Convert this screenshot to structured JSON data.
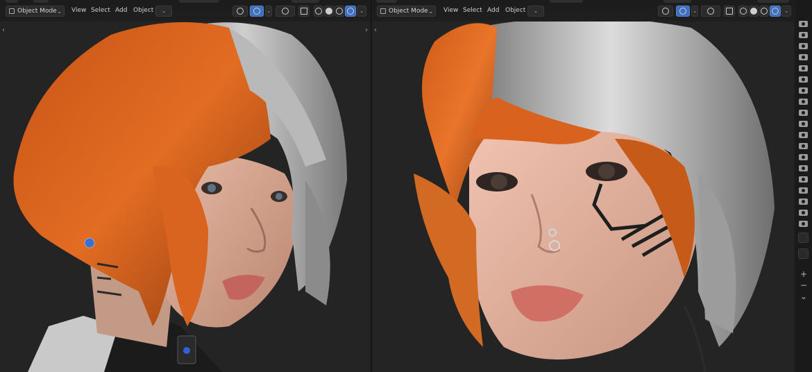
{
  "viewports": [
    {
      "name": "left",
      "header": {
        "mode_label": "Object Mode",
        "menu": [
          "View",
          "Select",
          "Add",
          "Object"
        ]
      }
    },
    {
      "name": "right",
      "header": {
        "mode_label": "Object Mode",
        "menu": [
          "View",
          "Select",
          "Add",
          "Object"
        ]
      }
    }
  ],
  "icons": {
    "mode": "object-mode-icon",
    "shading_active": "rendered-shading-icon",
    "collapse_left": "‹",
    "collapse_right": "›",
    "navigation_add": "+",
    "navigation_remove": "−",
    "navigation_chevron": "⌄"
  },
  "colors": {
    "header_bg": "#1c1c1c",
    "active_button": "#3f6fbf",
    "hair_orange": "#d9621b",
    "hair_silver": "#b8b8b8"
  }
}
